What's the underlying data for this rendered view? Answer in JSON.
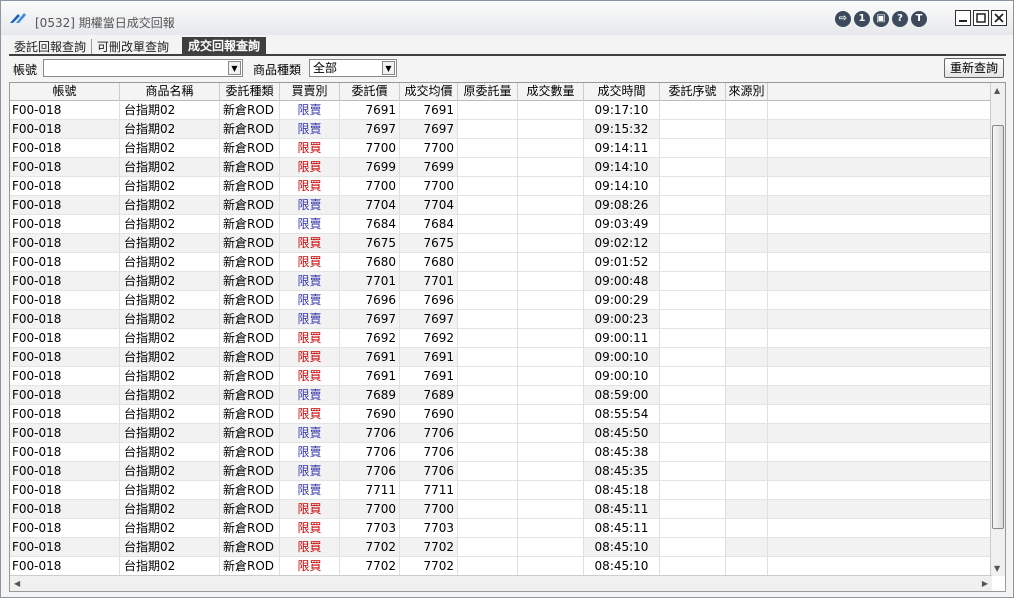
{
  "window": {
    "title": "[0532] 期權當日成交回報"
  },
  "tabs": [
    {
      "label": "委託回報查詢"
    },
    {
      "label": "可刪改單查詢"
    },
    {
      "label": "成交回報查詢"
    }
  ],
  "filter": {
    "account_label": "帳號",
    "account_value": "",
    "product_type_label": "商品種類",
    "product_type_value": "全部",
    "requery_label": "重新查詢"
  },
  "table": {
    "columns": [
      "帳號",
      "商品名稱",
      "委託種類",
      "買賣別",
      "委託價",
      "成交均價",
      "原委託量",
      "成交數量",
      "成交時間",
      "委託序號",
      "來源別"
    ],
    "rows": [
      {
        "account": "F00-018",
        "product": "台指期02",
        "order_type": "新倉ROD",
        "side": "限賣",
        "price": "7691",
        "avg": "7691",
        "orig_qty": "",
        "fill_qty": "",
        "time": "09:17:10",
        "seq": "",
        "source": ""
      },
      {
        "account": "F00-018",
        "product": "台指期02",
        "order_type": "新倉ROD",
        "side": "限賣",
        "price": "7697",
        "avg": "7697",
        "orig_qty": "",
        "fill_qty": "",
        "time": "09:15:32",
        "seq": "",
        "source": ""
      },
      {
        "account": "F00-018",
        "product": "台指期02",
        "order_type": "新倉ROD",
        "side": "限買",
        "price": "7700",
        "avg": "7700",
        "orig_qty": "",
        "fill_qty": "",
        "time": "09:14:11",
        "seq": "",
        "source": ""
      },
      {
        "account": "F00-018",
        "product": "台指期02",
        "order_type": "新倉ROD",
        "side": "限買",
        "price": "7699",
        "avg": "7699",
        "orig_qty": "",
        "fill_qty": "",
        "time": "09:14:10",
        "seq": "",
        "source": ""
      },
      {
        "account": "F00-018",
        "product": "台指期02",
        "order_type": "新倉ROD",
        "side": "限買",
        "price": "7700",
        "avg": "7700",
        "orig_qty": "",
        "fill_qty": "",
        "time": "09:14:10",
        "seq": "",
        "source": ""
      },
      {
        "account": "F00-018",
        "product": "台指期02",
        "order_type": "新倉ROD",
        "side": "限賣",
        "price": "7704",
        "avg": "7704",
        "orig_qty": "",
        "fill_qty": "",
        "time": "09:08:26",
        "seq": "",
        "source": ""
      },
      {
        "account": "F00-018",
        "product": "台指期02",
        "order_type": "新倉ROD",
        "side": "限賣",
        "price": "7684",
        "avg": "7684",
        "orig_qty": "",
        "fill_qty": "",
        "time": "09:03:49",
        "seq": "",
        "source": ""
      },
      {
        "account": "F00-018",
        "product": "台指期02",
        "order_type": "新倉ROD",
        "side": "限買",
        "price": "7675",
        "avg": "7675",
        "orig_qty": "",
        "fill_qty": "",
        "time": "09:02:12",
        "seq": "",
        "source": ""
      },
      {
        "account": "F00-018",
        "product": "台指期02",
        "order_type": "新倉ROD",
        "side": "限買",
        "price": "7680",
        "avg": "7680",
        "orig_qty": "",
        "fill_qty": "",
        "time": "09:01:52",
        "seq": "",
        "source": ""
      },
      {
        "account": "F00-018",
        "product": "台指期02",
        "order_type": "新倉ROD",
        "side": "限賣",
        "price": "7701",
        "avg": "7701",
        "orig_qty": "",
        "fill_qty": "",
        "time": "09:00:48",
        "seq": "",
        "source": ""
      },
      {
        "account": "F00-018",
        "product": "台指期02",
        "order_type": "新倉ROD",
        "side": "限賣",
        "price": "7696",
        "avg": "7696",
        "orig_qty": "",
        "fill_qty": "",
        "time": "09:00:29",
        "seq": "",
        "source": ""
      },
      {
        "account": "F00-018",
        "product": "台指期02",
        "order_type": "新倉ROD",
        "side": "限賣",
        "price": "7697",
        "avg": "7697",
        "orig_qty": "",
        "fill_qty": "",
        "time": "09:00:23",
        "seq": "",
        "source": ""
      },
      {
        "account": "F00-018",
        "product": "台指期02",
        "order_type": "新倉ROD",
        "side": "限買",
        "price": "7692",
        "avg": "7692",
        "orig_qty": "",
        "fill_qty": "",
        "time": "09:00:11",
        "seq": "",
        "source": ""
      },
      {
        "account": "F00-018",
        "product": "台指期02",
        "order_type": "新倉ROD",
        "side": "限買",
        "price": "7691",
        "avg": "7691",
        "orig_qty": "",
        "fill_qty": "",
        "time": "09:00:10",
        "seq": "",
        "source": ""
      },
      {
        "account": "F00-018",
        "product": "台指期02",
        "order_type": "新倉ROD",
        "side": "限買",
        "price": "7691",
        "avg": "7691",
        "orig_qty": "",
        "fill_qty": "",
        "time": "09:00:10",
        "seq": "",
        "source": ""
      },
      {
        "account": "F00-018",
        "product": "台指期02",
        "order_type": "新倉ROD",
        "side": "限賣",
        "price": "7689",
        "avg": "7689",
        "orig_qty": "",
        "fill_qty": "",
        "time": "08:59:00",
        "seq": "",
        "source": ""
      },
      {
        "account": "F00-018",
        "product": "台指期02",
        "order_type": "新倉ROD",
        "side": "限買",
        "price": "7690",
        "avg": "7690",
        "orig_qty": "",
        "fill_qty": "",
        "time": "08:55:54",
        "seq": "",
        "source": ""
      },
      {
        "account": "F00-018",
        "product": "台指期02",
        "order_type": "新倉ROD",
        "side": "限賣",
        "price": "7706",
        "avg": "7706",
        "orig_qty": "",
        "fill_qty": "",
        "time": "08:45:50",
        "seq": "",
        "source": ""
      },
      {
        "account": "F00-018",
        "product": "台指期02",
        "order_type": "新倉ROD",
        "side": "限賣",
        "price": "7706",
        "avg": "7706",
        "orig_qty": "",
        "fill_qty": "",
        "time": "08:45:38",
        "seq": "",
        "source": ""
      },
      {
        "account": "F00-018",
        "product": "台指期02",
        "order_type": "新倉ROD",
        "side": "限賣",
        "price": "7706",
        "avg": "7706",
        "orig_qty": "",
        "fill_qty": "",
        "time": "08:45:35",
        "seq": "",
        "source": ""
      },
      {
        "account": "F00-018",
        "product": "台指期02",
        "order_type": "新倉ROD",
        "side": "限賣",
        "price": "7711",
        "avg": "7711",
        "orig_qty": "",
        "fill_qty": "",
        "time": "08:45:18",
        "seq": "",
        "source": ""
      },
      {
        "account": "F00-018",
        "product": "台指期02",
        "order_type": "新倉ROD",
        "side": "限買",
        "price": "7700",
        "avg": "7700",
        "orig_qty": "",
        "fill_qty": "",
        "time": "08:45:11",
        "seq": "",
        "source": ""
      },
      {
        "account": "F00-018",
        "product": "台指期02",
        "order_type": "新倉ROD",
        "side": "限買",
        "price": "7703",
        "avg": "7703",
        "orig_qty": "",
        "fill_qty": "",
        "time": "08:45:11",
        "seq": "",
        "source": ""
      },
      {
        "account": "F00-018",
        "product": "台指期02",
        "order_type": "新倉ROD",
        "side": "限買",
        "price": "7702",
        "avg": "7702",
        "orig_qty": "",
        "fill_qty": "",
        "time": "08:45:10",
        "seq": "",
        "source": ""
      },
      {
        "account": "F00-018",
        "product": "台指期02",
        "order_type": "新倉ROD",
        "side": "限買",
        "price": "7702",
        "avg": "7702",
        "orig_qty": "",
        "fill_qty": "",
        "time": "08:45:10",
        "seq": "",
        "source": ""
      }
    ]
  },
  "colors": {
    "buy": "#cc0000",
    "sell": "#3333aa",
    "active_tab": "#3f3f3f"
  },
  "icons": [
    "app-logo-icon",
    "export-icon",
    "info-icon",
    "print-icon",
    "help-icon",
    "pin-icon",
    "minimize-icon",
    "maximize-icon",
    "close-icon"
  ]
}
